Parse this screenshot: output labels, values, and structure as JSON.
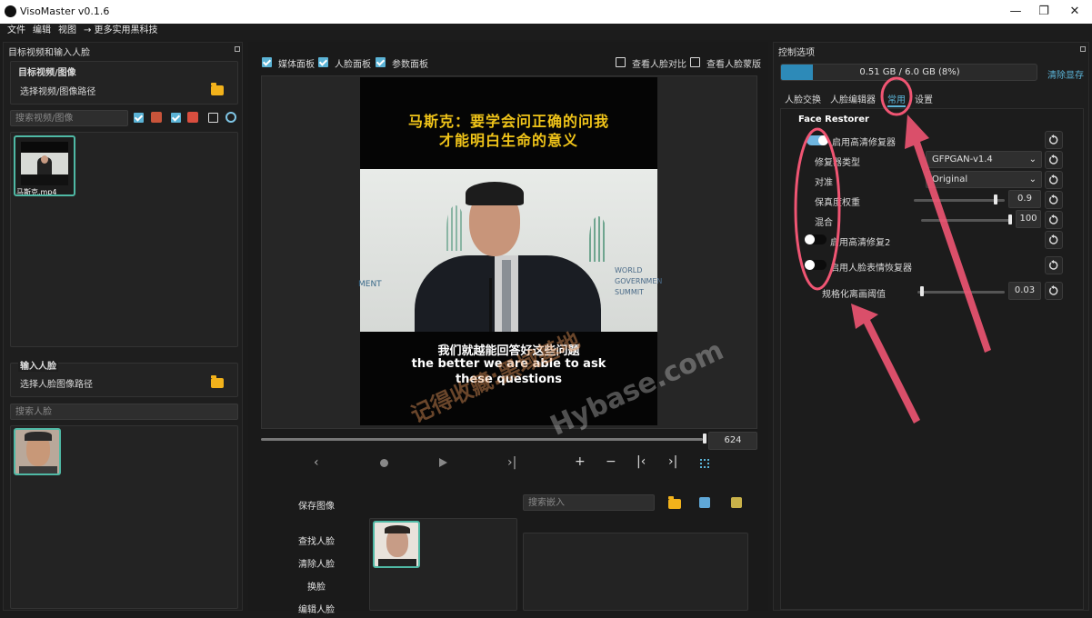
{
  "window": {
    "title": "VisoMaster v0.1.6",
    "minimize": "—",
    "maximize": "❐",
    "close": "✕"
  },
  "menu": [
    "文件",
    "编辑",
    "视图",
    "→ 更多实用黑科技"
  ],
  "left_panel": {
    "title": "目标视频和输入人脸",
    "target_section": "目标视频/图像",
    "select_target": "选择视频/图像路径",
    "search_target_placeholder": "搜索视频/图像",
    "target_files": [
      {
        "name": "马斯克.mp4"
      }
    ],
    "input_section": "输入人脸",
    "select_faces": "选择人脸图像路径",
    "search_faces_placeholder": "搜索人脸"
  },
  "center_panel": {
    "checkboxes": [
      {
        "label": "媒体面板",
        "checked": true
      },
      {
        "label": "人脸面板",
        "checked": true
      },
      {
        "label": "参数面板",
        "checked": true
      }
    ],
    "right_checkboxes": [
      {
        "label": "查看人脸对比",
        "checked": false
      },
      {
        "label": "查看人脸蒙版",
        "checked": false
      }
    ],
    "video": {
      "top_caption_line1": "马斯克：要学会问正确的问我",
      "top_caption_line2": "才能明白生命的意义",
      "sub_cn": "我们就越能回答好这些问题",
      "sub_en1": "the better we are able to ask",
      "sub_en2": "these questions",
      "bg_text_left": "MENT",
      "bg_text_right1": "WORLD",
      "bg_text_right2": "GOVERNMEN",
      "bg_text_right3": "SUMMIT"
    },
    "frame_number": "624",
    "timeline_progress": 0.97,
    "buttons": [
      "保存图像",
      "查找人脸",
      "清除人脸",
      "换脸",
      "编辑人脸"
    ],
    "search_embed_placeholder": "搜索嵌入"
  },
  "right_panel": {
    "title": "控制选项",
    "vram": "0.51 GB / 6.0 GB (8%)",
    "vram_fraction": 0.08,
    "clear_vram": "清除显存",
    "tabs": [
      "人脸交换",
      "人脸编辑器",
      "常用",
      "设置"
    ],
    "active_tab": "常用",
    "section": "Face Restorer",
    "enable_restorer": "启用高清修复器",
    "restorer_type_label": "修复器类型",
    "restorer_type_value": "GFPGAN-v1.4",
    "align_label": "对准",
    "align_value": "Original",
    "fidelity_label": "保真度权重",
    "fidelity_value": "0.9",
    "fidelity_fraction": 0.9,
    "blend_label": "混合",
    "blend_value": "100",
    "blend_fraction": 1.0,
    "enable_restorer2": "启用高清修复2",
    "enable_expression": "启用人脸表情恢复器",
    "threshold_label": "规格化离画阈值",
    "threshold_value": "0.03",
    "threshold_fraction": 0.03
  },
  "watermark": {
    "line1": "记得收藏:黑域基地",
    "line2": "Hybase.com"
  }
}
